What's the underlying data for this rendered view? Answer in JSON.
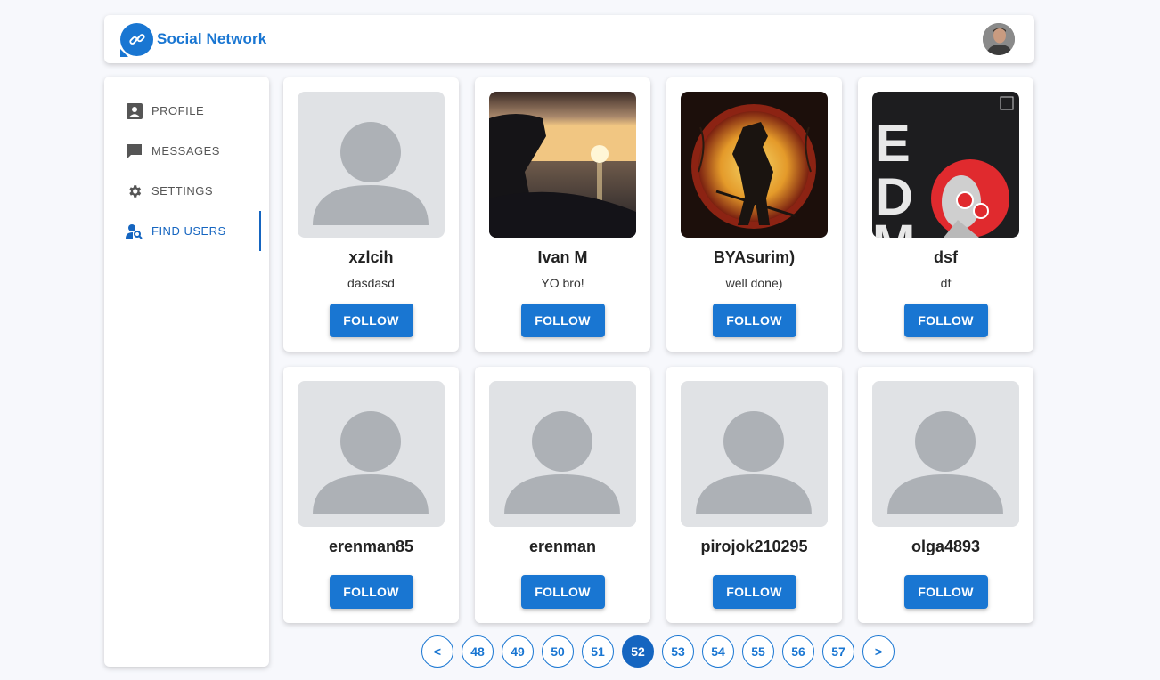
{
  "header": {
    "brand": "Social Network"
  },
  "sidebar": {
    "items": [
      {
        "label": "PROFILE",
        "icon": "profile-icon"
      },
      {
        "label": "MESSAGES",
        "icon": "messages-icon"
      },
      {
        "label": "SETTINGS",
        "icon": "gear-icon"
      },
      {
        "label": "FIND USERS",
        "icon": "find-users-icon",
        "active": true
      }
    ]
  },
  "users": [
    {
      "name": "xzlcih",
      "status": "dasdasd",
      "photo": "default-avatar",
      "button": "FOLLOW"
    },
    {
      "name": "Ivan M",
      "status": "YO bro!",
      "photo": "sunset-sea",
      "button": "FOLLOW"
    },
    {
      "name": "BYAsurim)",
      "status": "well done)",
      "photo": "samurai-art",
      "button": "FOLLOW"
    },
    {
      "name": "dsf",
      "status": "df",
      "photo": "edm-poster",
      "button": "FOLLOW"
    },
    {
      "name": "erenman85",
      "status": "",
      "photo": "default-avatar",
      "button": "FOLLOW"
    },
    {
      "name": "erenman",
      "status": "",
      "photo": "default-avatar",
      "button": "FOLLOW"
    },
    {
      "name": "pirojok210295",
      "status": "",
      "photo": "default-avatar",
      "button": "FOLLOW"
    },
    {
      "name": "olga4893",
      "status": "",
      "photo": "default-avatar",
      "button": "FOLLOW"
    }
  ],
  "pagination": {
    "prev": "<",
    "next": ">",
    "pages": [
      "48",
      "49",
      "50",
      "51",
      "52",
      "53",
      "54",
      "55",
      "56",
      "57"
    ],
    "current": "52"
  },
  "colors": {
    "accent": "#1976d2",
    "background": "#f7f8fc",
    "placeholder": "#e0e2e5",
    "placeholder_figure": "#adb1b6"
  }
}
